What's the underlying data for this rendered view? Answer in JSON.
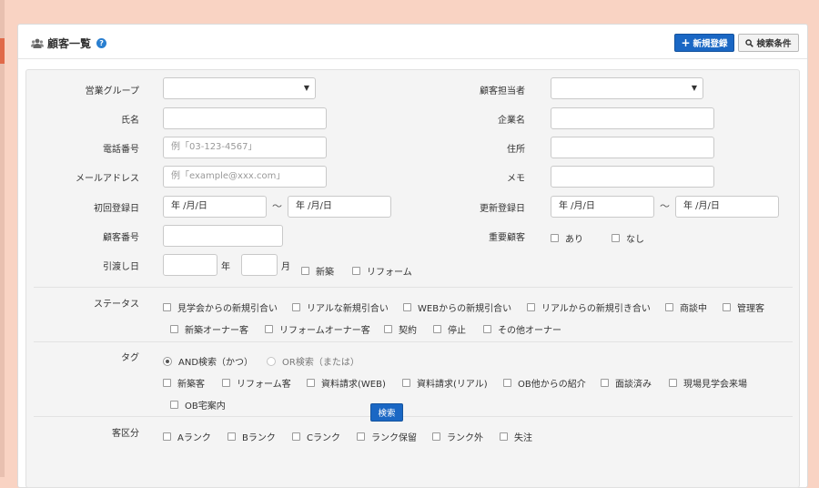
{
  "header": {
    "title": "顧客一覧",
    "help": "?",
    "new_button": "新規登録",
    "new_button_icon": "+",
    "filter_button": "検索条件"
  },
  "form": {
    "sales_group_label": "営業グループ",
    "customer_rep_label": "顧客担当者",
    "name_label": "氏名",
    "company_label": "企業名",
    "phone_label": "電話番号",
    "phone_placeholder": "例「03-123-4567」",
    "address_label": "住所",
    "email_label": "メールアドレス",
    "email_placeholder": "例「example@xxx.com」",
    "memo_label": "メモ",
    "first_reg_label": "初回登録日",
    "update_reg_label": "更新登録日",
    "date_placeholder": "年 /月/日",
    "range_sep": "～",
    "customer_no_label": "顧客番号",
    "important_label": "重要顧客",
    "important_options": [
      "あり",
      "なし"
    ],
    "handover_label": "引渡し日",
    "year_unit": "年",
    "month_unit": "月",
    "handover_options": [
      "新築",
      "リフォーム"
    ],
    "status_label": "ステータス",
    "status_options": [
      "見学会からの新規引合い",
      "リアルな新規引合い",
      "WEBからの新規引合い",
      "リアルからの新規引き合い",
      "商談中",
      "管理客",
      "新築オーナー客",
      "リフォームオーナー客",
      "契約",
      "停止",
      "その他オーナー"
    ],
    "tag_label": "タグ",
    "tag_modes": [
      "AND検索（かつ）",
      "OR検索（または）"
    ],
    "tag_options": [
      "新築客",
      "リフォーム客",
      "資料請求(WEB)",
      "資料請求(リアル)",
      "OB他からの紹介",
      "面談済み",
      "現場見学会来場",
      "OB宅案内"
    ],
    "class_label": "客区分",
    "class_options": [
      "Aランク",
      "Bランク",
      "Cランク",
      "ランク保留",
      "ランク外",
      "失注"
    ],
    "search_button": "検索"
  },
  "colors": {
    "background": "#f9d3c3",
    "primary_button": "#1a67c4",
    "help_icon": "#2a7fd0"
  }
}
